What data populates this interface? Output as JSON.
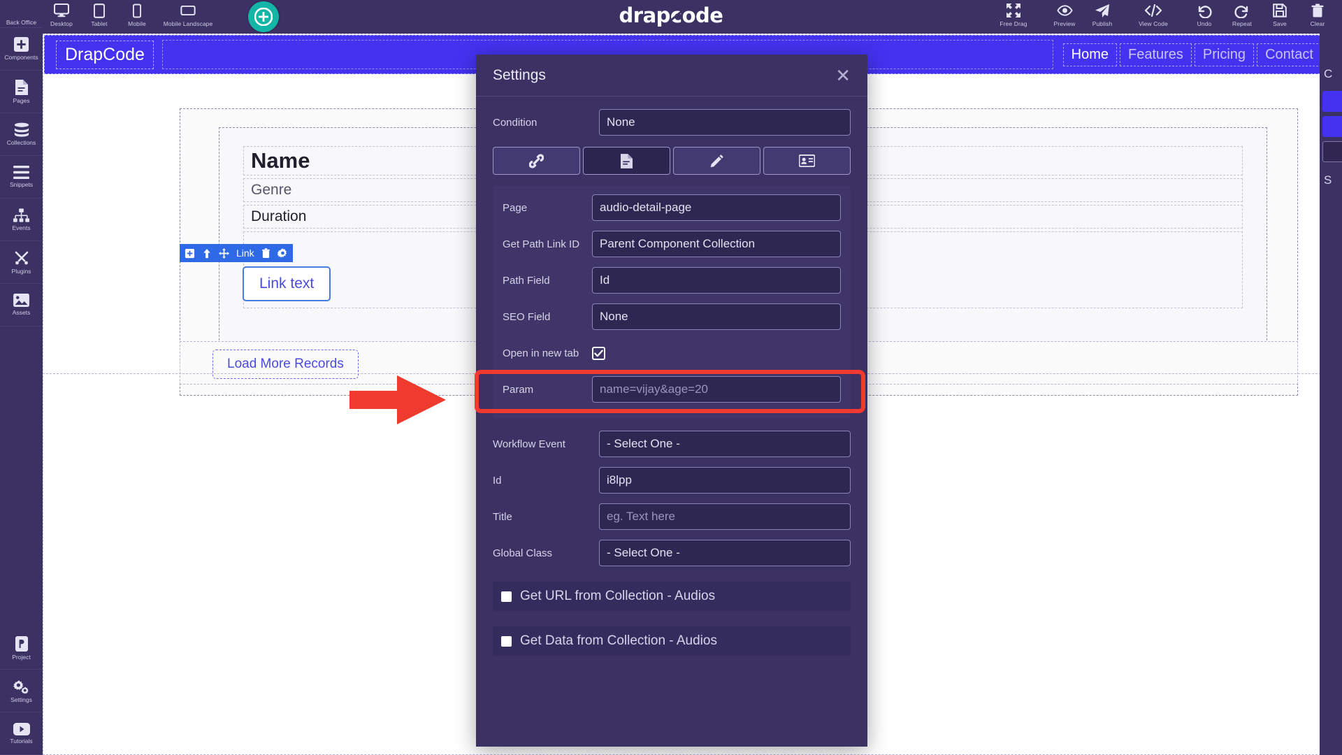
{
  "app": {
    "logo": "drapcode",
    "brand_color": "#13b5a6"
  },
  "topbar": {
    "left_items": [
      {
        "name": "back-office",
        "label": "Back Office",
        "icon": "user-icon"
      },
      {
        "name": "desktop",
        "label": "Desktop",
        "icon": "monitor-icon"
      },
      {
        "name": "tablet",
        "label": "Tablet",
        "icon": "tablet-icon"
      },
      {
        "name": "mobile",
        "label": "Mobile",
        "icon": "phone-icon"
      },
      {
        "name": "mobile-landscape",
        "label": "Mobile Landscape",
        "icon": "phone-landscape-icon"
      }
    ],
    "add_button_icon": "plus-circle-icon",
    "right_items": [
      {
        "name": "free-drag",
        "label": "Free Drag",
        "icon": "move-arrows-icon"
      },
      {
        "name": "preview",
        "label": "Preview",
        "icon": "eye-icon"
      },
      {
        "name": "publish",
        "label": "Publish",
        "icon": "paper-plane-icon"
      },
      {
        "name": "view-code",
        "label": "View Code",
        "icon": "code-brackets-icon"
      },
      {
        "name": "undo",
        "label": "Undo",
        "icon": "undo-arrow-icon"
      },
      {
        "name": "repeat",
        "label": "Repeat",
        "icon": "redo-arrow-icon"
      },
      {
        "name": "save",
        "label": "Save",
        "icon": "floppy-disk-icon"
      },
      {
        "name": "clear",
        "label": "Clear",
        "icon": "trash-icon"
      }
    ]
  },
  "sidebar": {
    "top_items": [
      {
        "name": "components",
        "label": "Components",
        "icon": "plus-square-icon"
      },
      {
        "name": "pages",
        "label": "Pages",
        "icon": "document-icon"
      },
      {
        "name": "collections",
        "label": "Collections",
        "icon": "database-icon"
      },
      {
        "name": "snippets",
        "label": "Snippets",
        "icon": "lines-icon"
      },
      {
        "name": "events",
        "label": "Events",
        "icon": "sitemap-icon"
      },
      {
        "name": "plugins",
        "label": "Plugins",
        "icon": "tools-icon"
      },
      {
        "name": "assets",
        "label": "Assets",
        "icon": "image-icon"
      }
    ],
    "bottom_items": [
      {
        "name": "project",
        "label": "Project",
        "icon": "project-badge-icon"
      },
      {
        "name": "settings",
        "label": "Settings",
        "icon": "gears-icon"
      },
      {
        "name": "tutorials",
        "label": "Tutorials",
        "icon": "video-play-icon"
      }
    ]
  },
  "canvas": {
    "site_brand": "DrapCode",
    "nav_links": [
      {
        "label": "Home",
        "active": true
      },
      {
        "label": "Features",
        "active": false
      },
      {
        "label": "Pricing",
        "active": false
      },
      {
        "label": "Contact",
        "active": false
      }
    ],
    "fields": {
      "name": "Name",
      "genre": "Genre",
      "duration": "Duration"
    },
    "link_text": "Link text",
    "load_more": "Load More Records",
    "selection_toolbar": {
      "label": "Link",
      "icons": [
        "add-icon",
        "select-parent-icon",
        "move-icon",
        "delete-icon",
        "settings-icon"
      ]
    }
  },
  "modal": {
    "title": "Settings",
    "close_icon": "close-icon",
    "condition": {
      "label": "Condition",
      "value": "None"
    },
    "tabs": [
      {
        "name": "tab-link",
        "icon": "chain-link-icon",
        "active": false
      },
      {
        "name": "tab-page",
        "icon": "document-icon",
        "active": true
      },
      {
        "name": "tab-style",
        "icon": "pencil-icon",
        "active": false
      },
      {
        "name": "tab-identity",
        "icon": "id-card-icon",
        "active": false
      }
    ],
    "link_group": [
      {
        "name": "page",
        "label": "Page",
        "value": "audio-detail-page",
        "placeholder": ""
      },
      {
        "name": "get-path-link-id",
        "label": "Get Path Link ID",
        "value": "Parent Component Collection",
        "placeholder": ""
      },
      {
        "name": "path-field",
        "label": "Path Field",
        "value": "Id",
        "placeholder": ""
      },
      {
        "name": "seo-field",
        "label": "SEO Field",
        "value": "None",
        "placeholder": ""
      }
    ],
    "open_in_new_tab": {
      "label": "Open in new tab",
      "checked": true
    },
    "param": {
      "label": "Param",
      "value": "",
      "placeholder": "name=vijay&age=20"
    },
    "general_fields": [
      {
        "name": "workflow-event",
        "label": "Workflow Event",
        "value": "- Select One -",
        "placeholder": ""
      },
      {
        "name": "id",
        "label": "Id",
        "value": "i8lpp",
        "placeholder": ""
      },
      {
        "name": "title",
        "label": "Title",
        "value": "",
        "placeholder": "eg. Text here"
      },
      {
        "name": "global-class",
        "label": "Global Class",
        "value": "- Select One -",
        "placeholder": ""
      }
    ],
    "sections": [
      {
        "name": "get-url-from-collection",
        "label": "Get URL from Collection - Audios",
        "checked": false
      },
      {
        "name": "get-data-from-collection",
        "label": "Get Data from Collection - Audios",
        "checked": false
      }
    ]
  },
  "annotation": {
    "arrow_color": "#f0392f",
    "highlight_color": "#f0392f",
    "highlight_target": "Open in new tab"
  }
}
